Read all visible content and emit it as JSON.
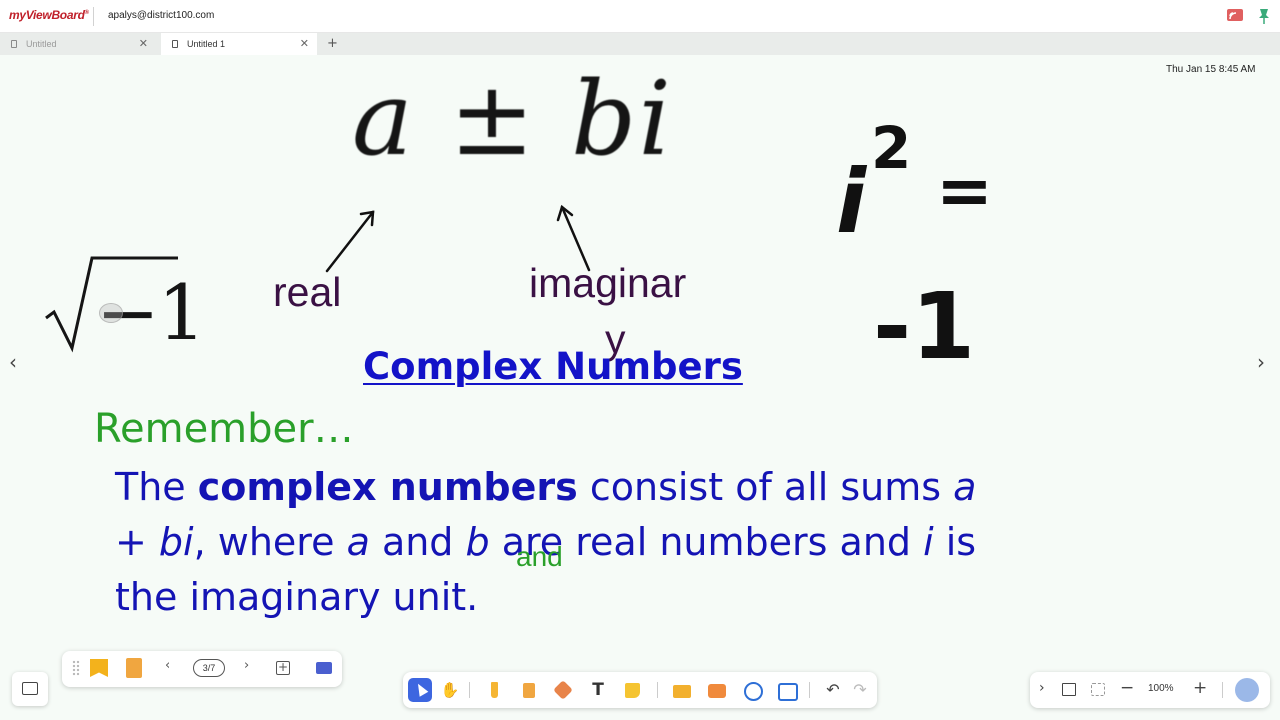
{
  "app": {
    "logo": "myViewBoard",
    "account": "apalys@district100.com"
  },
  "tabs": [
    {
      "label": "Untitled",
      "active": false
    },
    {
      "label": "Untitled 1",
      "active": true
    }
  ],
  "datetime": "Thu Jan 15 8:45 AM",
  "canvas": {
    "formula": "a ± bi",
    "sqrt_expr": "−1",
    "annotation_real": "real",
    "annotation_imaginary_line1": "imaginar",
    "annotation_imaginary_line2": "y",
    "i_base": "i",
    "i_exponent": "2",
    "equals": "=",
    "neg_one": "-1",
    "title": "Complex Numbers",
    "remember": "Remember…",
    "definition": {
      "l1_a": "The ",
      "l1_bold": "complex numbers",
      "l1_b": " consist of all sums ",
      "l1_var_a": "a",
      "l2_a": "+ ",
      "l2_var_bi": "bi",
      "l2_b": ", where ",
      "l2_var_a": "a",
      "l2_c": " and ",
      "l2_var_b": "b",
      "l2_d": " are real numbers and ",
      "l2_var_i": "i",
      "l2_e": " is",
      "l3": "the imaginary unit."
    },
    "handwritten_and": "and"
  },
  "page_panel": {
    "page_counter": "3/7"
  },
  "zoom": {
    "level": "100%"
  },
  "colors": {
    "accent": "#3d66e0",
    "title_blue": "#1313c8",
    "body_blue": "#1414b4",
    "green": "#2aa02a",
    "annotation_purple": "#3a1144",
    "logo_red": "#c0202a"
  }
}
